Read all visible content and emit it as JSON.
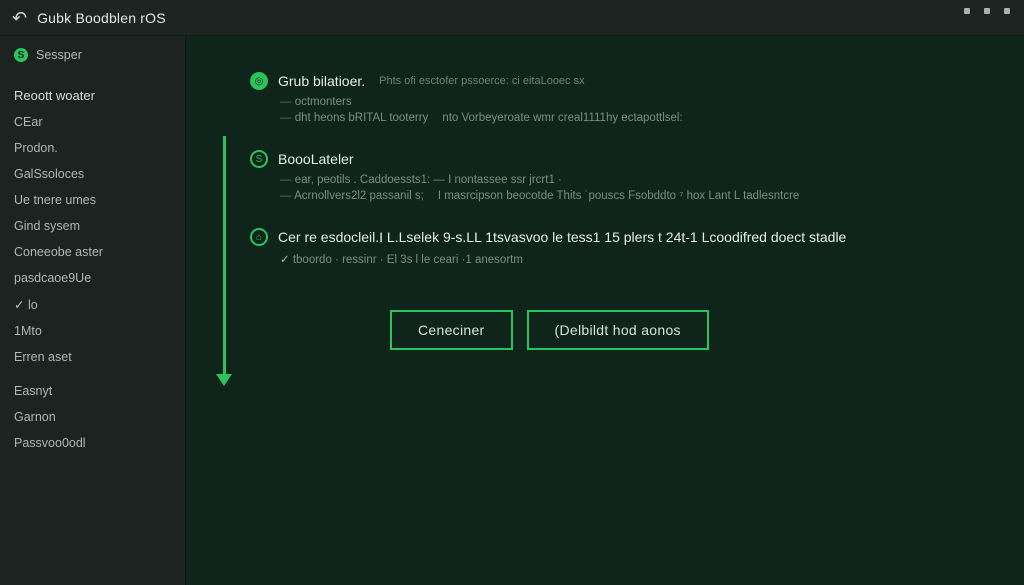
{
  "window": {
    "title": "Gubk Boodblen rOS"
  },
  "session": {
    "label": "Sessper",
    "icon_letter": "S"
  },
  "sidebar": {
    "section_title": "Reoott woater",
    "items": [
      {
        "label": "CEar"
      },
      {
        "label": "Prodon."
      },
      {
        "label": "GalSsoloces"
      },
      {
        "label": "Ue tnere umes"
      },
      {
        "label": "Gind sysem"
      },
      {
        "label": "Coneeobe aster"
      },
      {
        "label": "pasdcaoe9Ue"
      },
      {
        "label": "lo",
        "checked": true
      },
      {
        "label": "1Mto"
      },
      {
        "label": "Erren aset"
      }
    ],
    "items_b": [
      {
        "label": "Easnyt"
      },
      {
        "label": "Garnon"
      },
      {
        "label": "Passvoo0odl"
      }
    ]
  },
  "main": {
    "blocks": [
      {
        "icon_glyph": "◎",
        "icon_style": "solid",
        "title": "Grub bilatioer.",
        "desc": "Phts ofi esctofer pssoerce: ci eitaLooec sx",
        "subs": [
          {
            "lead": "octmonters",
            "col2": ""
          },
          {
            "lead": "dht heons bRITAL tooterry",
            "col2": "nto Vorbeyeroate wmr creal1111hy ectapottlsel:"
          }
        ]
      },
      {
        "icon_glyph": "S",
        "icon_style": "ring",
        "title": "BoooLateler",
        "desc": "",
        "subs": [
          {
            "lead": "ear, peotils . Caddoessts1: — I nontassee ssr jrcrt1 ·",
            "col2": ""
          },
          {
            "lead": "Acrnollvers2l2 passanil s;",
            "col2": "I masrcipson beocotde Thits ˙pouscs Fsobddto ⁷ hox Lant L tadlesntcre"
          }
        ]
      },
      {
        "icon_glyph": "⌂",
        "icon_style": "ring",
        "title": "Cer re esdocleil.I L.Lselek 9-s.LL 1tsvasvoo le tess1 15 plers t 24t-1 Lcoodifred doect stadle",
        "desc": "",
        "subs": [
          {
            "lead": "tboordo · ressinr · El 3s l le ceari ·1 anesortm",
            "checked": true
          }
        ]
      }
    ],
    "buttons": {
      "cancel": "Ceneciner",
      "confirm": "(Delbildt hod aonos"
    }
  }
}
